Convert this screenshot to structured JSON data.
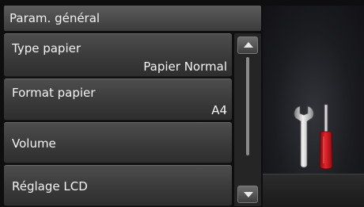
{
  "header": {
    "title": "Param. général"
  },
  "menu": {
    "items": [
      {
        "label": "Type papier",
        "value": "Papier Normal"
      },
      {
        "label": "Format papier",
        "value": "A4"
      },
      {
        "label": "Volume"
      },
      {
        "label": "Réglage LCD"
      }
    ]
  },
  "scroll": {
    "up_icon": "arrow-up-icon",
    "down_icon": "arrow-down-icon"
  },
  "illustration": {
    "icon": "wrench-screwdriver-icon",
    "handle_color": "#c8141b"
  }
}
